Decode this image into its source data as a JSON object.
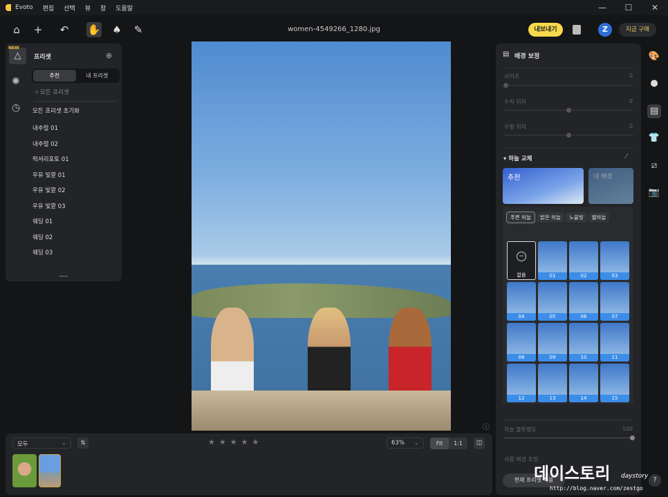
{
  "app": {
    "name": "Evoto",
    "menu": [
      "편집",
      "선택",
      "뷰",
      "창",
      "도움말"
    ]
  },
  "toolbar": {
    "filename": "women-4549266_1280.jpg",
    "export_label": "내보내기",
    "avatar_letter": "Z",
    "buy_label": "지금 구매"
  },
  "left_panel": {
    "new_badge": "NEW",
    "title": "프리셋",
    "tabs": [
      "추천",
      "내 프리셋"
    ],
    "filter": "모든 프리셋",
    "presets": [
      "모든 프리셋 초기화",
      "내추럴 01",
      "내추럴 02",
      "럭셔리포토 01",
      "우유 빛깔 01",
      "우유 빛깔 02",
      "우유 빛깔 03",
      "웨딩 01",
      "웨딩 02",
      "웨딩 03"
    ]
  },
  "bottom": {
    "filter_select": "모두",
    "rating": 0,
    "zoom": "63%",
    "fit": "Fit",
    "one_to_one": "1:1"
  },
  "right_panel": {
    "title": "배경 보정",
    "sliders": [
      {
        "label": "사이즈",
        "value": "0"
      },
      {
        "label": "수직 위치",
        "value": "0"
      },
      {
        "label": "수평 위치",
        "value": "0"
      }
    ],
    "sky_section": "하늘 교체",
    "sky_tabs": [
      "추천",
      "내 배경"
    ],
    "chips": [
      "푸른 하늘",
      "밝은 하늘",
      "노을빛",
      "별하늘"
    ],
    "none_label": "없음",
    "sky_items": [
      "01",
      "02",
      "03",
      "04",
      "05",
      "06",
      "07",
      "08",
      "09",
      "10",
      "11",
      "12",
      "13",
      "14",
      "15"
    ],
    "opacity_label": "하늘 불투명도",
    "opacity_value": "100",
    "person_label": "사람 배경 조정",
    "apply_button": "현재 프리셋 적용"
  },
  "watermark": {
    "title": "데이스토리",
    "sub": "daystory",
    "url": "http://blog.naver.com/zestgo"
  },
  "colors": {
    "accent": "#f7d94c",
    "selection": "#3c8de8"
  }
}
